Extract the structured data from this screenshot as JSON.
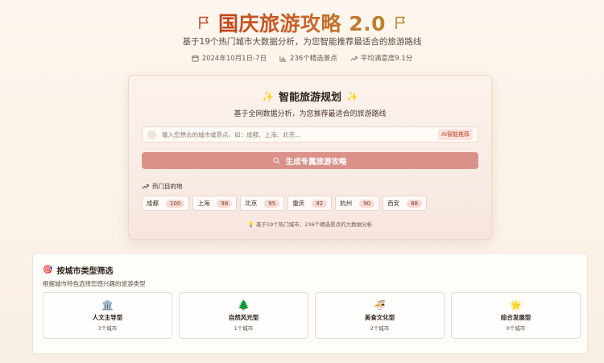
{
  "header": {
    "title": "国庆旅游攻略 2.0",
    "subtitle": "基于19个热门城市大数据分析，为您智能推荐最适合的旅游路线",
    "stats": [
      {
        "icon": "calendar-icon",
        "label": "2024年10月1日-7日"
      },
      {
        "icon": "bar-chart-icon",
        "label": "236个精选景点"
      },
      {
        "icon": "trend-up-icon",
        "label": "平均满意度9.1分"
      }
    ]
  },
  "planner": {
    "title": "智能旅游规划",
    "subtitle": "基于全网数据分析，为您推荐最适合的旅游路线",
    "search_placeholder": "输入您想去的城市或景点，如：成都、上海、北京...",
    "ai_badge": "AI智能推荐",
    "generate_label": "生成专属旅游攻略",
    "hot_label": "热门目的地",
    "hot_destinations": [
      {
        "city": "成都",
        "score": "100"
      },
      {
        "city": "上海",
        "score": "98"
      },
      {
        "city": "北京",
        "score": "95"
      },
      {
        "city": "重庆",
        "score": "92"
      },
      {
        "city": "杭州",
        "score": "90"
      },
      {
        "city": "西安",
        "score": "88"
      }
    ],
    "footer": "💡 基于19个热门城市、236个精选景点的大数据分析"
  },
  "filter": {
    "title": "按城市类型筛选",
    "subtitle": "根据城市特色选择您感兴趣的旅游类型",
    "types": [
      {
        "icon": "🏛️",
        "name": "人文主导型",
        "count": "3个城市"
      },
      {
        "icon": "🌲",
        "name": "自然风光型",
        "count": "1个城市"
      },
      {
        "icon": "🍜",
        "name": "美食文化型",
        "count": "2个城市"
      },
      {
        "icon": "🌟",
        "name": "综合发展型",
        "count": "0个城市"
      }
    ]
  },
  "colors": {
    "accent": "#c8542a",
    "button": "#d9918a",
    "score_bg": "#f6d9d3"
  }
}
